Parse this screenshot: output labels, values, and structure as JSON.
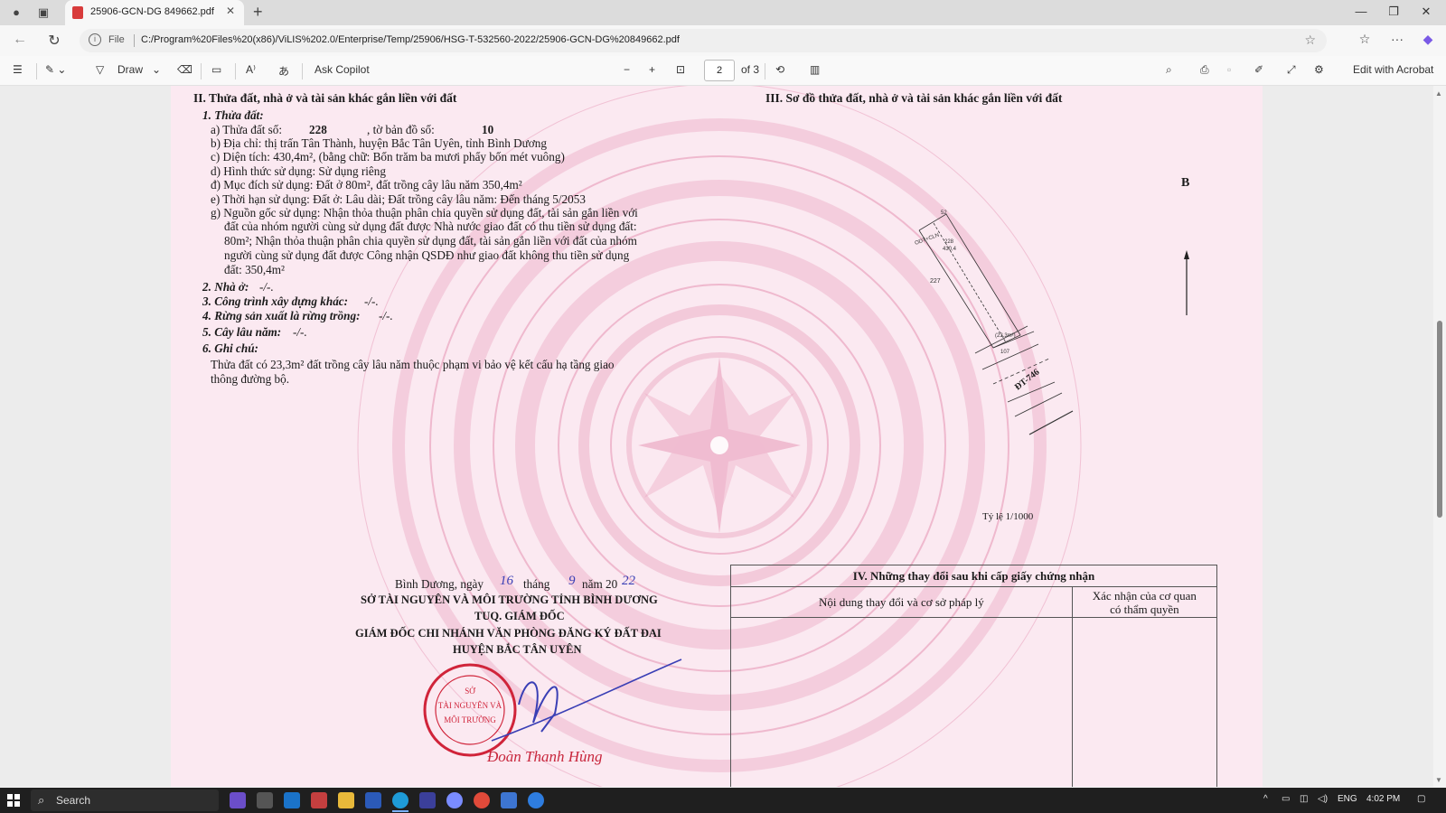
{
  "browser": {
    "tab_title": "25906-GCN-DG 849662.pdf",
    "file_label": "File",
    "url": "C:/Program%20Files%20(x86)/ViLIS%202.0/Enterprise/Temp/25906/HSG-T-532560-2022/25906-GCN-DG%20849662.pdf"
  },
  "pdf_toolbar": {
    "draw_label": "Draw",
    "ask_copilot_label": "Ask Copilot",
    "current_page": "2",
    "page_of": "of 3",
    "edit_acrobat_label": "Edit with Acrobat"
  },
  "document": {
    "section2_title": "II. Thửa đất, nhà ở và tài sản khác gắn liền với đất",
    "section3_title": "III. Sơ đồ thửa đất, nhà ở và tài sản khác gắn liền với đất",
    "parcel_heading": "1. Thửa đất:",
    "line_a_label": "a) Thửa đất số:",
    "parcel_no": "228",
    "sheet_label": ", tờ bản đồ số:",
    "sheet_no": "10",
    "line_b": "b) Địa chỉ:  thị trấn Tân Thành, huyện Bắc Tân Uyên, tỉnh Bình Dương",
    "line_c": "c) Diện tích:          430,4m², (bằng chữ: Bốn trăm ba mươi phẩy bốn mét vuông)",
    "line_d": "d) Hình thức sử dụng:   Sử dụng riêng",
    "line_dd": "đ) Mục đích sử dụng:  Đất ở 80m², đất trồng cây lâu năm 350,4m²",
    "line_e": "e) Thời hạn sử dụng:  Đất ở: Lâu dài; Đất trồng cây lâu năm: Đến tháng 5/2053",
    "line_g1": "g) Nguồn gốc sử dụng:  Nhận thỏa thuận phân chia quyền sử dụng đất, tài sản gắn liền với",
    "line_g2": "đất của nhóm người cùng sử dụng đất được Nhà nước giao đất có thu tiền sử dụng đất:",
    "line_g3": "80m²; Nhận thỏa thuận phân chia quyền sử dụng đất, tài sản gắn liền với đất của nhóm",
    "line_g4": "người cùng sử dụng đất được Công nhận QSDĐ như giao đất không thu tiền sử dụng",
    "line_g5": "đất: 350,4m²",
    "house_label": "2. Nhà ở:",
    "house_val": "-/-.",
    "construction_label": "3. Công trình xây dựng khác:",
    "construction_val": "-/-.",
    "forest_label": "4. Rừng sản xuất là rừng trồng:",
    "forest_val": "-/-.",
    "perennial_label": "5. Cây lâu năm:",
    "perennial_val": "-/-.",
    "notes_label": "6. Ghi chú:",
    "notes_1": "Thửa đất có 23,3m² đất trồng cây lâu năm thuộc phạm vi bảo vệ kết cấu hạ tầng giao",
    "notes_2": "thông đường bộ.",
    "north_label": "B",
    "road_label": "ĐT-746",
    "plot_labels": {
      "p1": "52 ",
      "p2": "ODT+CLN",
      "p3": "228",
      "p4": "430,4",
      "p5": "227",
      "p6": "(23,3m²)",
      "p7": "107"
    },
    "scale": "Tỷ lệ 1/1000",
    "date_line_1": "Bình Dương, ngày",
    "date_day": "16",
    "date_line_2": "tháng",
    "date_month": "9",
    "date_line_3": "năm 20",
    "date_year": "22",
    "org_1": "SỞ TÀI NGUYÊN VÀ MÔI TRƯỜNG TỈNH BÌNH DƯƠNG",
    "org_2": "TUQ. GIÁM ĐỐC",
    "org_3": "GIÁM ĐỐC CHI NHÁNH VĂN PHÒNG ĐĂNG KÝ ĐẤT ĐAI",
    "org_4": "HUYỆN BẮC TÂN UYÊN",
    "signer": "Đoàn Thanh Hùng",
    "changes_title": "IV. Những thay đổi sau khi cấp giấy chứng nhận",
    "changes_col1": "Nội dung thay đổi và cơ sở pháp lý",
    "changes_col2a": "Xác nhận của cơ quan",
    "changes_col2b": "có thẩm quyền"
  },
  "taskbar": {
    "search_label": "Search",
    "lang": "ENG",
    "time": "4:02 PM"
  },
  "colors": {
    "page_bg": "#fbe9f1",
    "watermark": "#e89ab8",
    "stamp_red": "#d0243a",
    "signature_blue": "#3a3fb5"
  }
}
